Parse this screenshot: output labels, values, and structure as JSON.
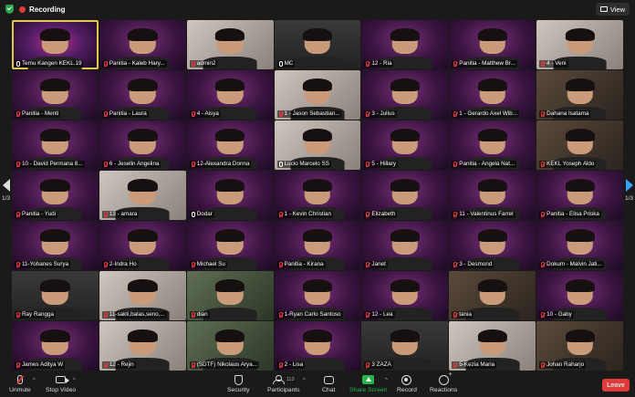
{
  "topbar": {
    "recording_label": "Recording",
    "view_label": "View"
  },
  "pager": {
    "left_label": "1/3",
    "right_label": "1/3"
  },
  "participants": [
    {
      "name": "Temu Kangen KEKL.19",
      "muted": false,
      "bg": "bg-neon",
      "active": true
    },
    {
      "name": "Panitia - Kaleb Hary...",
      "muted": true,
      "bg": "bg-bright"
    },
    {
      "name": "admin2",
      "muted": true,
      "bg": "bg-light"
    },
    {
      "name": "MC",
      "muted": false,
      "bg": "bg-plain"
    },
    {
      "name": "12 - Ria",
      "muted": true,
      "bg": "bg-bright"
    },
    {
      "name": "Panitia - Matthew Br...",
      "muted": true,
      "bg": "bg-bright"
    },
    {
      "name": "4 - Veni",
      "muted": true,
      "bg": "bg-light"
    },
    {
      "name": "Panitia - Menti",
      "muted": true,
      "bg": "bg-bright"
    },
    {
      "name": "Panitia - Laura",
      "muted": true,
      "bg": "bg-bright"
    },
    {
      "name": "4 - Aisya",
      "muted": true,
      "bg": "bg-bright"
    },
    {
      "name": "1 - Jason Sebastian...",
      "muted": true,
      "bg": "bg-light"
    },
    {
      "name": "3 - Julius",
      "muted": true,
      "bg": "bg-bright"
    },
    {
      "name": "1 - Gerardo Axel Wib...",
      "muted": true,
      "bg": "bg-bright"
    },
    {
      "name": "Dahana Isatama",
      "muted": true,
      "bg": "bg-room"
    },
    {
      "name": "10 - David Permana 8...",
      "muted": true,
      "bg": "bg-bright"
    },
    {
      "name": "6 - Jeselin Angelina",
      "muted": true,
      "bg": "bg-bright"
    },
    {
      "name": "12-Alexandra Donna",
      "muted": true,
      "bg": "bg-bright"
    },
    {
      "name": "Lucio Marcelo SS",
      "muted": false,
      "bg": "bg-light"
    },
    {
      "name": "5 - Hillary",
      "muted": true,
      "bg": "bg-bright"
    },
    {
      "name": "Panitia - Angela Nat...",
      "muted": true,
      "bg": "bg-bright"
    },
    {
      "name": "KEKL Yoseph Aldo",
      "muted": true,
      "bg": "bg-room"
    },
    {
      "name": "Panitia - Yudi",
      "muted": true,
      "bg": "bg-bright"
    },
    {
      "name": "13 - amara",
      "muted": true,
      "bg": "bg-light"
    },
    {
      "name": "Dodar",
      "muted": false,
      "bg": "bg-bright"
    },
    {
      "name": "1 - Kevin Christian",
      "muted": true,
      "bg": "bg-bright"
    },
    {
      "name": "Elizabeth",
      "muted": true,
      "bg": "bg-bright"
    },
    {
      "name": "11 - Valentinus Farrel",
      "muted": true,
      "bg": "bg-bright"
    },
    {
      "name": "Panitia - Elisa Priska",
      "muted": true,
      "bg": "bg-bright"
    },
    {
      "name": "11-Yohanes Surya",
      "muted": true,
      "bg": "bg-bright"
    },
    {
      "name": "2-Indra Ho",
      "muted": true,
      "bg": "bg-bright"
    },
    {
      "name": "Michael Su",
      "muted": true,
      "bg": "bg-bright"
    },
    {
      "name": "Panitia - Kirana",
      "muted": true,
      "bg": "bg-bright"
    },
    {
      "name": "Janet",
      "muted": true,
      "bg": "bg-bright"
    },
    {
      "name": "3 - Desmond",
      "muted": true,
      "bg": "bg-bright"
    },
    {
      "name": "Dokum - Malvin Jati...",
      "muted": true,
      "bg": "bg-bright"
    },
    {
      "name": "Ray Rangga",
      "muted": true,
      "bg": "bg-plain"
    },
    {
      "name": "11-sakti,balas,seno,...",
      "muted": true,
      "bg": "bg-light"
    },
    {
      "name": "dian",
      "muted": true,
      "bg": "bg-green"
    },
    {
      "name": "1-Ryan Carlo Santoso",
      "muted": true,
      "bg": "bg-bright"
    },
    {
      "name": "12 - Lea",
      "muted": true,
      "bg": "bg-bright"
    },
    {
      "name": "tania",
      "muted": true,
      "bg": "bg-room"
    },
    {
      "name": "10 - Gaby",
      "muted": true,
      "bg": "bg-bright"
    },
    {
      "name": "James Aditya W",
      "muted": true,
      "bg": "bg-bright"
    },
    {
      "name": "12 - Rejin",
      "muted": true,
      "bg": "bg-light"
    },
    {
      "name": "(SDTF) Nikolaus Arya...",
      "muted": true,
      "bg": "bg-green"
    },
    {
      "name": "2 - Lisa",
      "muted": true,
      "bg": "bg-bright"
    },
    {
      "name": "3 ZAZA",
      "muted": true,
      "bg": "bg-plain"
    },
    {
      "name": "5-Kezia Maria",
      "muted": true,
      "bg": "bg-light"
    },
    {
      "name": "Johan Raharjo",
      "muted": true,
      "bg": "bg-room"
    }
  ],
  "toolbar": {
    "unmute_label": "Unmute",
    "stop_video_label": "Stop Video",
    "security_label": "Security",
    "participants_label": "Participants",
    "participants_count": "112",
    "chat_label": "Chat",
    "share_label": "Share Screen",
    "record_label": "Record",
    "reactions_label": "Reactions",
    "leave_label": "Leave"
  },
  "colors": {
    "accent_green": "#27b34b",
    "leave_red": "#e03a3a",
    "active_border": "#e2c84a"
  }
}
